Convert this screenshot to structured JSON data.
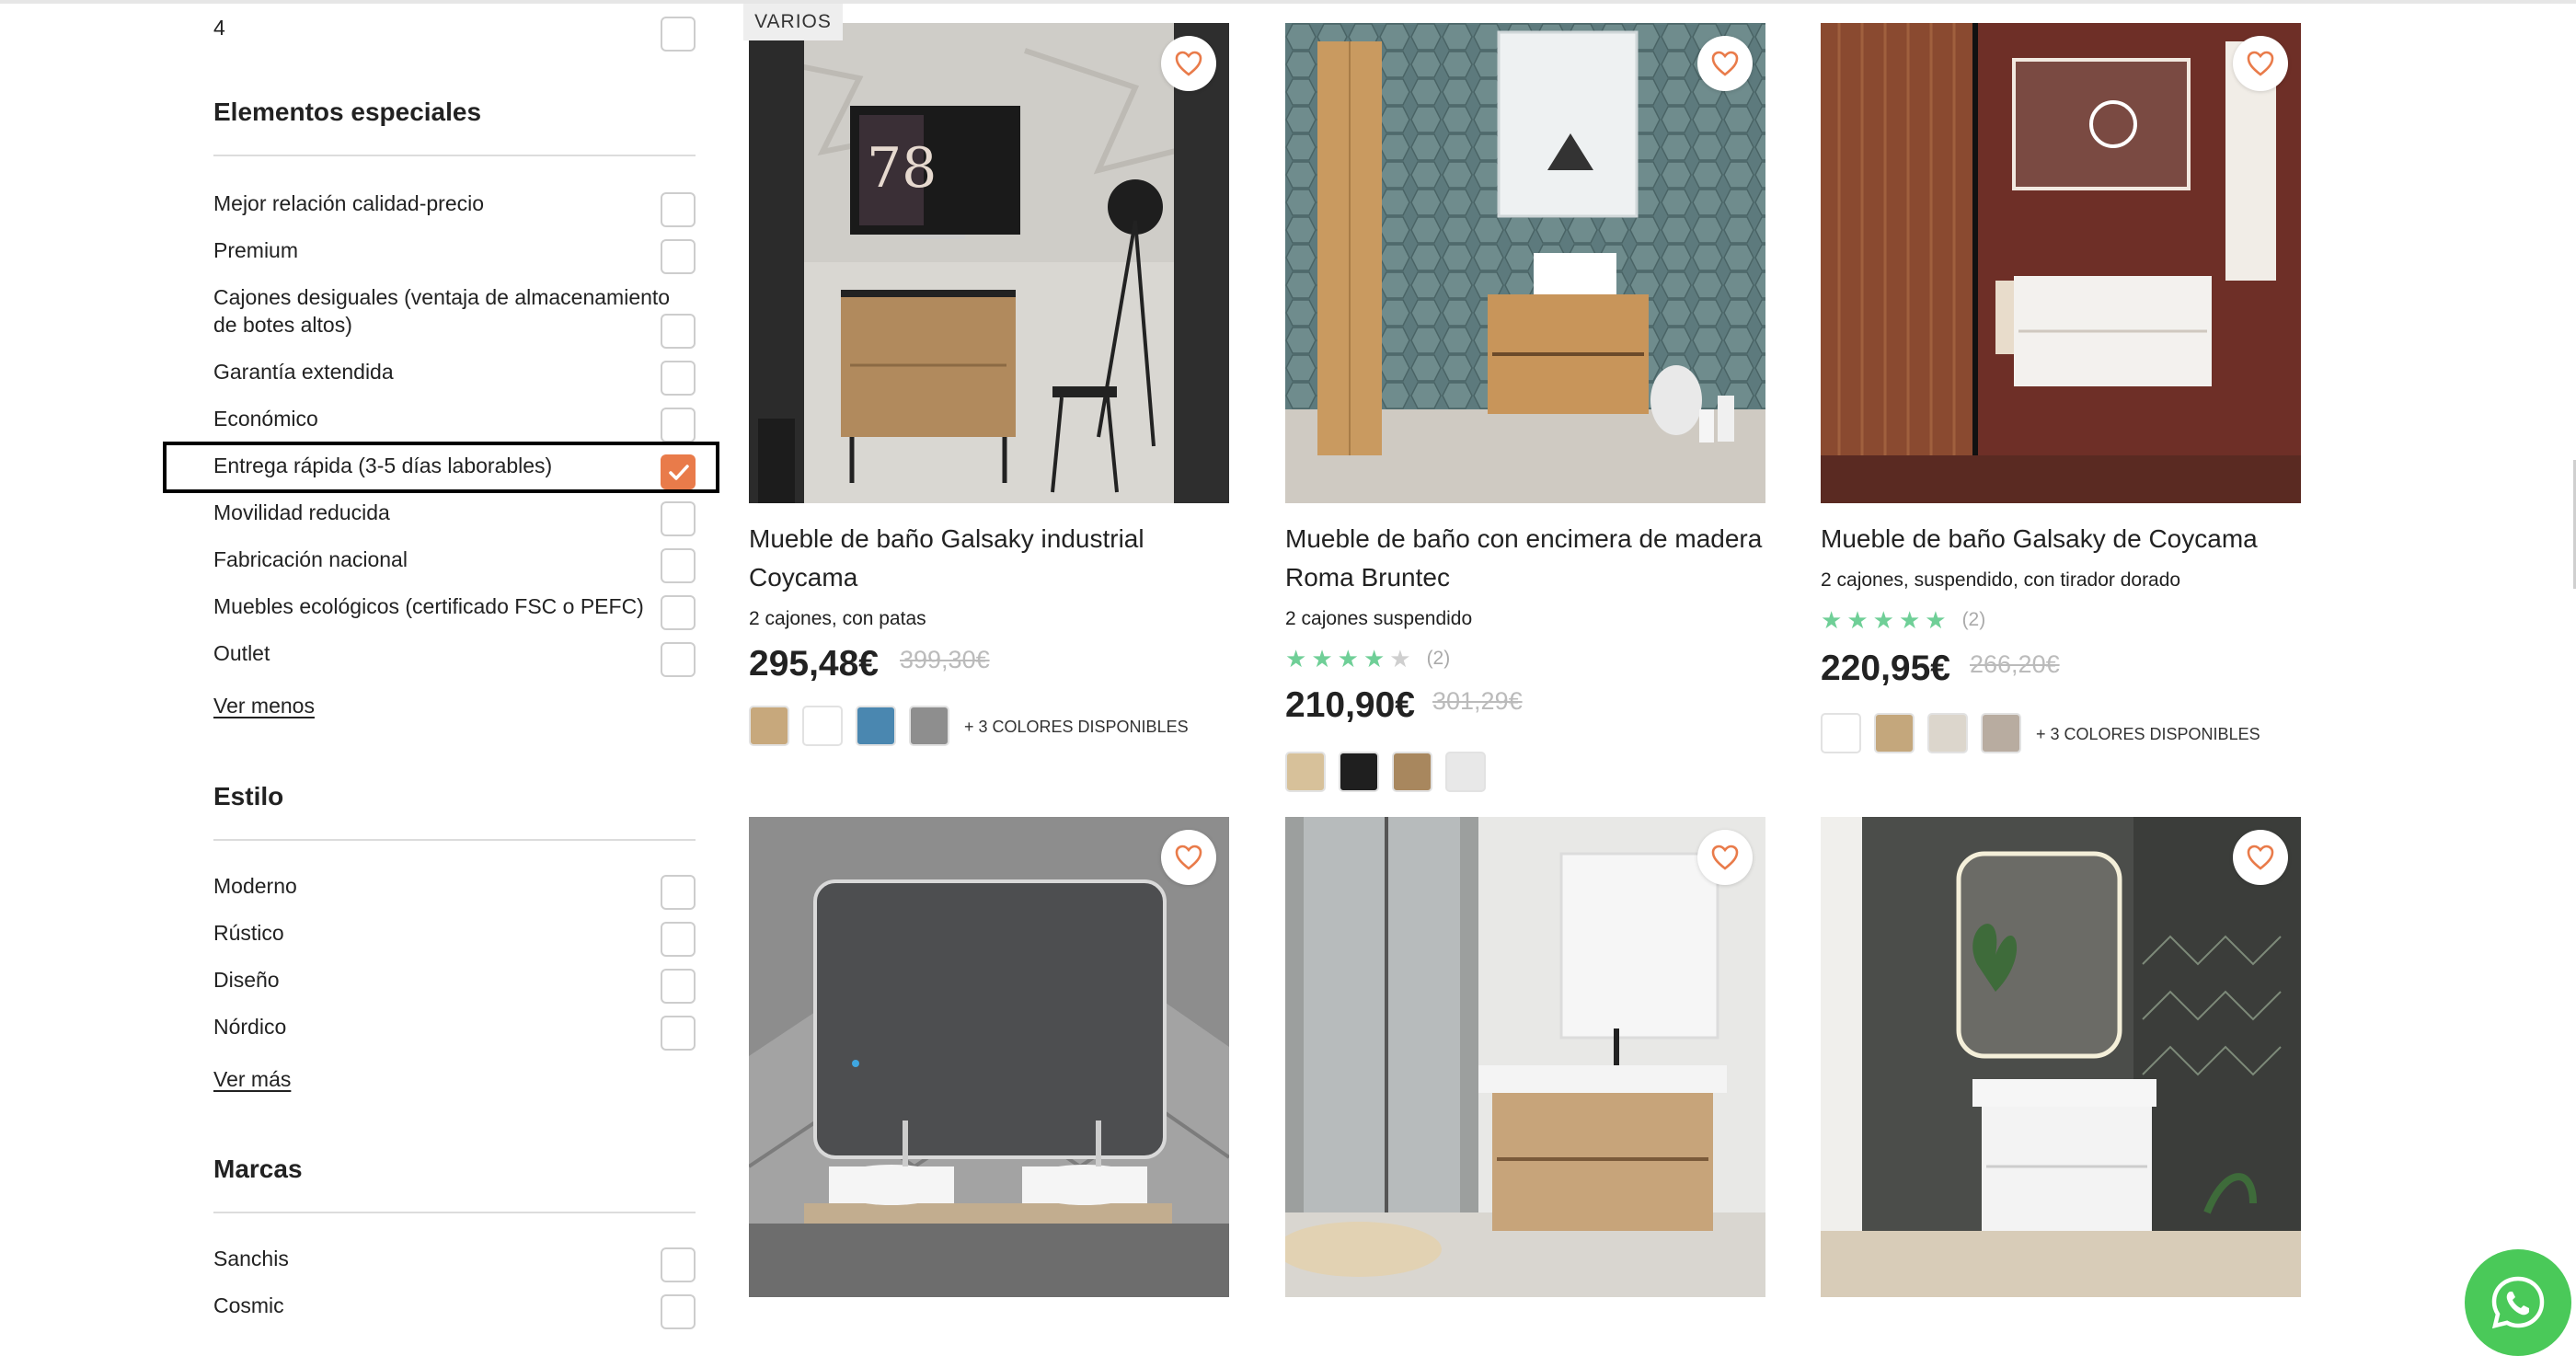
{
  "filters": {
    "prev_option": "4",
    "special": {
      "title": "Elementos especiales",
      "options": [
        "Mejor relación calidad-precio",
        "Premium",
        "Cajones desiguales (ventaja de almacenamiento de botes altos)",
        "Garantía extendida",
        "Económico",
        "Entrega rápida (3-5 días laborables)",
        "Movilidad reducida",
        "Fabricación nacional",
        "Muebles ecológicos (certificado FSC o PEFC)",
        "Outlet"
      ],
      "checked_option": "Entrega rápida (3-5 días laborables)",
      "toggle_link": "Ver menos"
    },
    "style": {
      "title": "Estilo",
      "options": [
        "Moderno",
        "Rústico",
        "Diseño",
        "Nórdico"
      ],
      "toggle_link": "Ver más"
    },
    "brands": {
      "title": "Marcas",
      "options": [
        "Sanchis",
        "Cosmic"
      ]
    }
  },
  "products": {
    "tag": "VARIOS",
    "more_colors": "+ 3 COLORES DISPONIBLES",
    "items": [
      {
        "title": "Mueble de baño Galsaky industrial Coycama",
        "subtitle": "2 cajones, con patas",
        "price": "295,48€",
        "old_price": "399,30€",
        "swatches": [
          "#c7a87c",
          "#ffffff",
          "#4a87b0",
          "#8e8e8e"
        ]
      },
      {
        "title": "Mueble de baño con encimera de madera Roma Bruntec",
        "subtitle": "2 cajones suspendido",
        "rating": 4,
        "rating_count": "(2)",
        "price": "210,90€",
        "old_price": "301,29€",
        "swatches": [
          "#d7c19a",
          "#1f1f1f",
          "#a8875e",
          "#e8e8e8"
        ]
      },
      {
        "title": "Mueble de baño Galsaky de Coycama",
        "subtitle": "2 cajones, suspendido, con tirador dorado",
        "rating": 5,
        "rating_count": "(2)",
        "price": "220,95€",
        "old_price": "266,20€",
        "swatches": [
          "#ffffff",
          "#c4a77c",
          "#dcd6cc",
          "#b8aca0"
        ]
      }
    ]
  },
  "colors": {
    "accent": "#e97b4a",
    "star_filled": "#6fcf97",
    "star_empty": "#cfcfcf",
    "whatsapp": "#4ac959"
  },
  "icons": {
    "favorite": "heart-outline-icon",
    "checkbox_checked": "check-icon",
    "chat": "whatsapp-icon"
  }
}
